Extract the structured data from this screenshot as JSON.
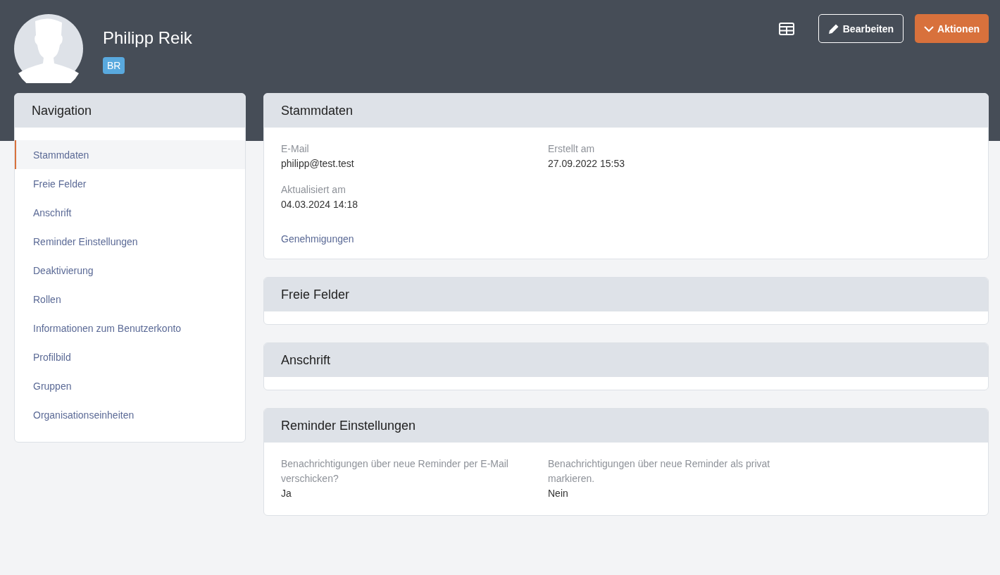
{
  "profile": {
    "name": "Philipp Reik",
    "badge": "BR"
  },
  "toolbar": [
    {
      "kind": "icon"
    },
    {
      "kind": "outline",
      "label": "Bearbeiten"
    },
    {
      "kind": "primary",
      "label": "Aktionen"
    }
  ],
  "navigation": {
    "title": "Navigation",
    "items": [
      {
        "label": "Stammdaten",
        "selected": true
      },
      {
        "label": "Freie Felder",
        "selected": false
      },
      {
        "label": "Anschrift",
        "selected": false
      },
      {
        "label": "Reminder Einstellungen",
        "selected": false
      },
      {
        "label": "Deaktivierung",
        "selected": false
      },
      {
        "label": "Rollen",
        "selected": false
      },
      {
        "label": "Informationen zum Benutzerkonto",
        "selected": false
      },
      {
        "label": "Profilbild",
        "selected": false
      },
      {
        "label": "Gruppen",
        "selected": false
      },
      {
        "label": "Organisationseinheiten",
        "selected": false
      }
    ]
  },
  "sections": [
    {
      "title": "Stammdaten",
      "fields": [
        {
          "label": "E-Mail",
          "value": "philipp@test.test"
        },
        {
          "label": "Erstellt am",
          "value": "27.09.2022 15:53"
        },
        {
          "label": "Aktualisiert am",
          "value": "04.03.2024 14:18"
        }
      ],
      "links": [
        "Genehmigungen"
      ]
    },
    {
      "title": "Freie Felder"
    },
    {
      "title": "Anschrift"
    },
    {
      "title": "Reminder Einstellungen",
      "fields": [
        {
          "label": "Benachrichtigungen über neue Reminder per E-Mail verschicken?",
          "value": "Ja"
        },
        {
          "label": "Benachrichtigungen über neue Reminder als privat markieren.",
          "value": "Nein"
        }
      ]
    }
  ]
}
